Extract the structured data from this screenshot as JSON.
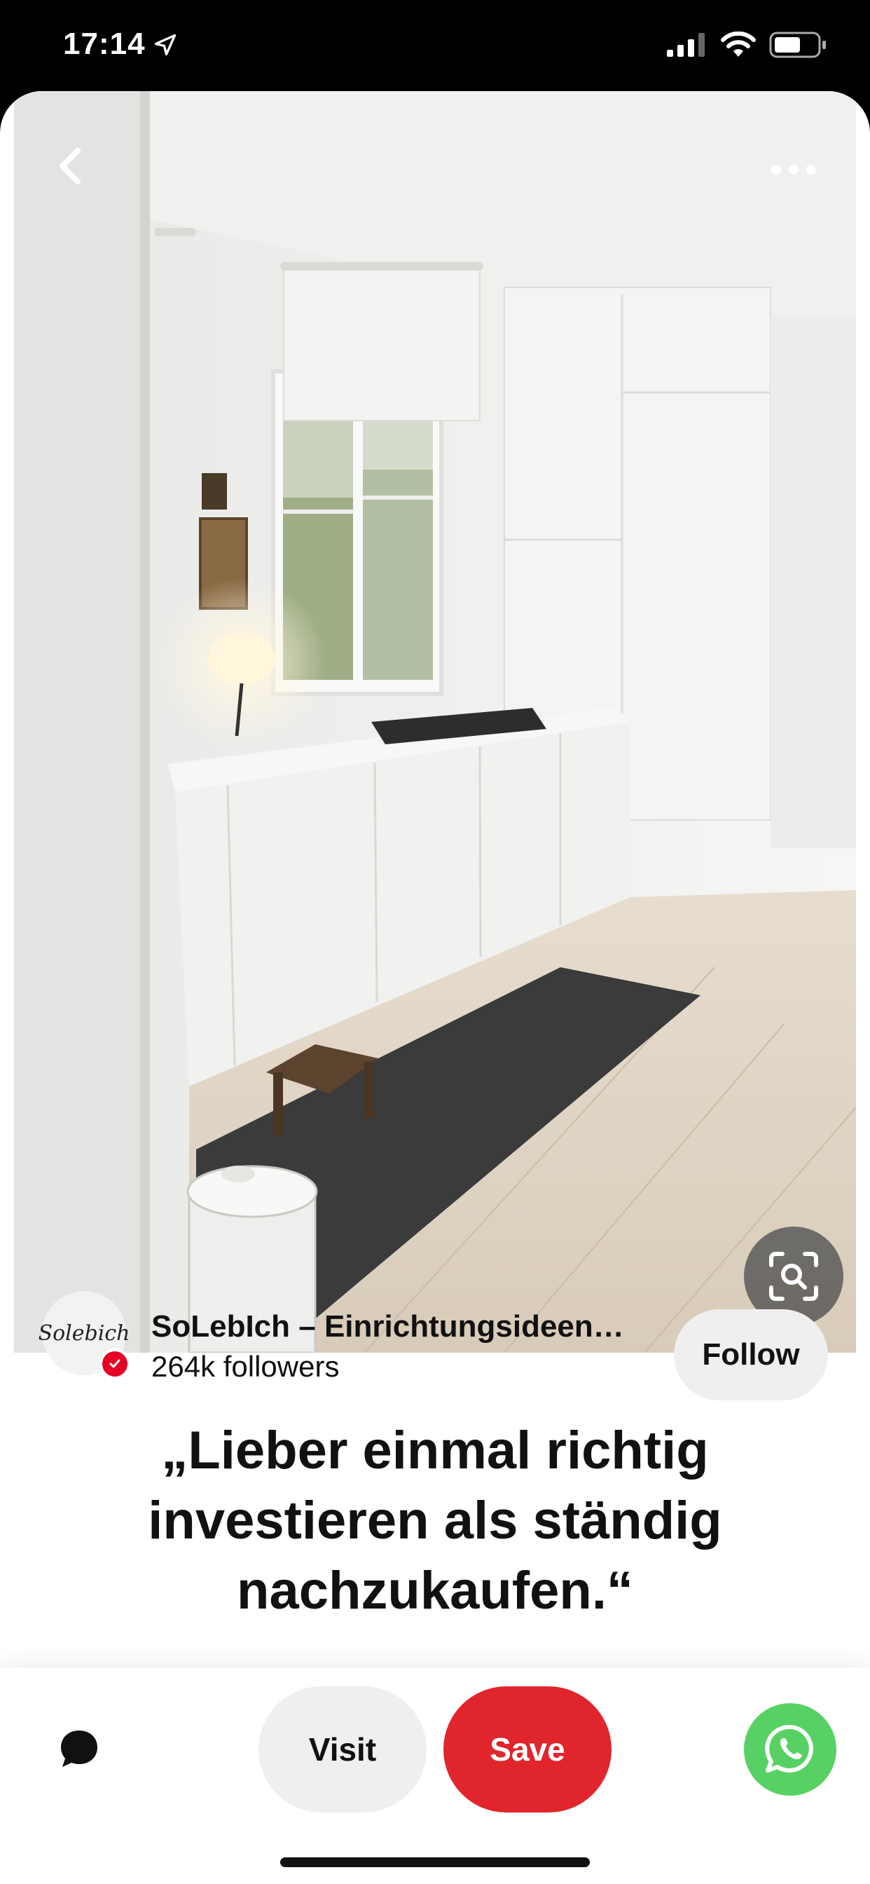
{
  "status_bar": {
    "time": "17:14"
  },
  "pin": {
    "creator": {
      "avatar_text": "Solebich",
      "name": "SoLebIch – Einrichtungsideen…",
      "followers": "264k followers",
      "follow_label": "Follow"
    },
    "title": "„Lieber einmal richtig investieren als ständig",
    "title_cut_line": "nachzukaufen.“"
  },
  "actions": {
    "visit_label": "Visit",
    "save_label": "Save"
  },
  "colors": {
    "save": "#e0252c",
    "whatsapp": "#57d163",
    "verified": "#e60023"
  },
  "icons": [
    "back-icon",
    "more-icon",
    "visual-search-icon",
    "comment-icon",
    "whatsapp-icon",
    "location-arrow-icon",
    "signal-icon",
    "wifi-icon",
    "battery-icon",
    "verified-icon"
  ]
}
